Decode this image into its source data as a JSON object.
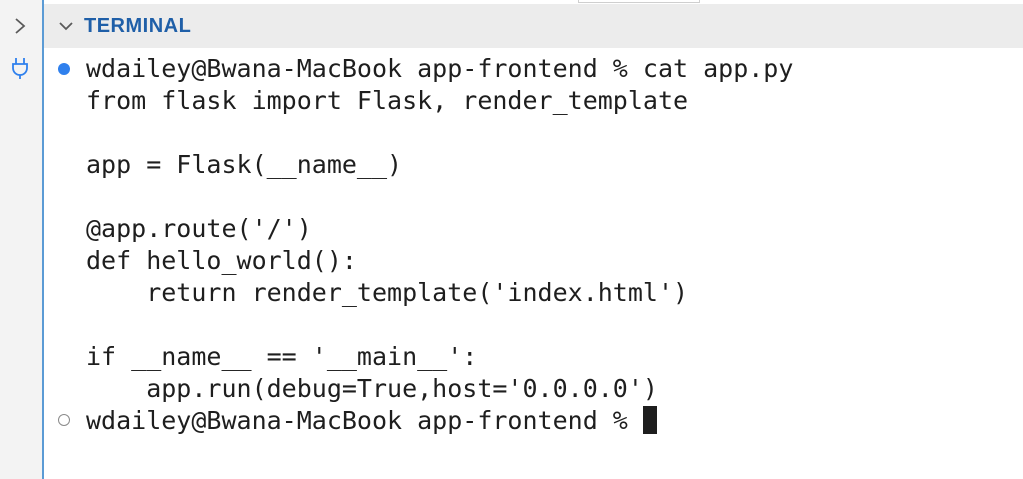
{
  "panel": {
    "title": "TERMINAL"
  },
  "gutter": {
    "icons": [
      "chevron-right-icon",
      "plug-icon"
    ]
  },
  "terminal": {
    "prompt_line": "wdailey@Bwana-MacBook app-frontend % cat app.py",
    "output_lines": [
      "from flask import Flask, render_template",
      "",
      "app = Flask(__name__)",
      "",
      "@app.route('/')",
      "def hello_world():",
      "    return render_template('index.html')",
      "",
      "if __name__ == '__main__':",
      "    app.run(debug=True,host='0.0.0.0')"
    ],
    "current_prompt": "wdailey@Bwana-MacBook app-frontend % "
  },
  "colors": {
    "accent": "#1f5fa8",
    "marker_success": "#2f80ed",
    "divider": "#5b9bd5",
    "text": "#1e1e1e"
  }
}
